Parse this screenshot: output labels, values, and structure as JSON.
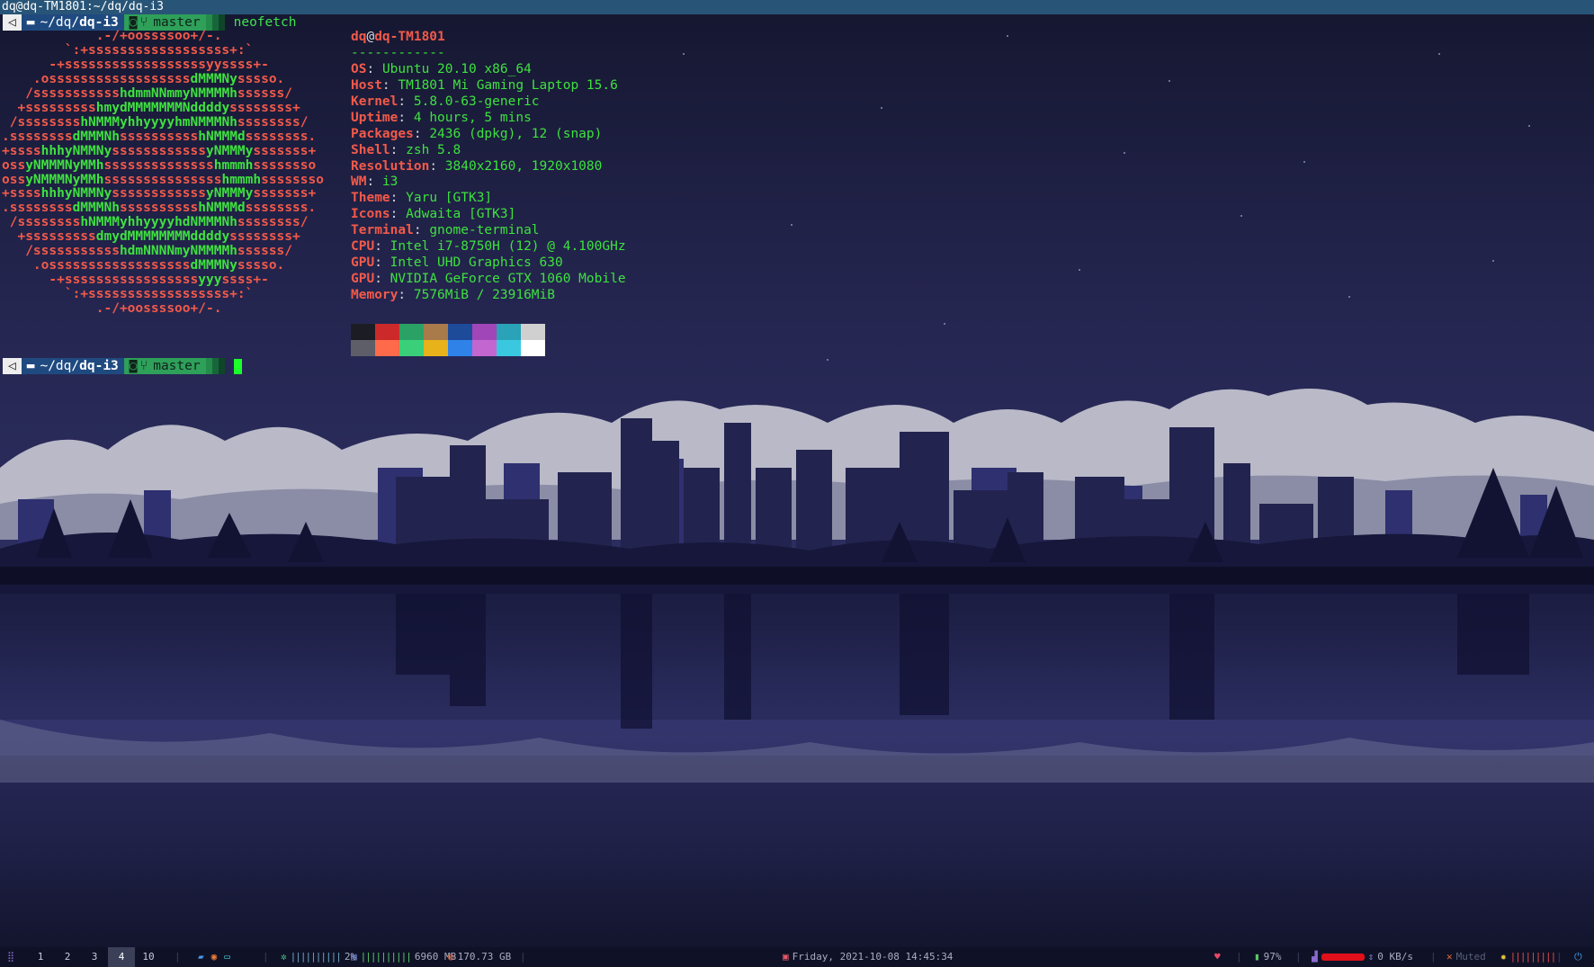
{
  "window": {
    "title": "dq@dq-TM1801:~/dq/dq-i3"
  },
  "prompt": {
    "dir_prefix": "~/dq/",
    "dir_name": "dq-i3",
    "branch": "master",
    "command": "neofetch"
  },
  "neofetch": {
    "user": "dq",
    "at": "@",
    "host": "dq-TM1801",
    "separator": "------------",
    "info": [
      {
        "key": "OS",
        "value": "Ubuntu 20.10 x86_64"
      },
      {
        "key": "Host",
        "value": "TM1801 Mi Gaming Laptop 15.6"
      },
      {
        "key": "Kernel",
        "value": "5.8.0-63-generic"
      },
      {
        "key": "Uptime",
        "value": "4 hours, 5 mins"
      },
      {
        "key": "Packages",
        "value": "2436 (dpkg), 12 (snap)"
      },
      {
        "key": "Shell",
        "value": "zsh 5.8"
      },
      {
        "key": "Resolution",
        "value": "3840x2160, 1920x1080"
      },
      {
        "key": "WM",
        "value": "i3"
      },
      {
        "key": "Theme",
        "value": "Yaru [GTK3]"
      },
      {
        "key": "Icons",
        "value": "Adwaita [GTK3]"
      },
      {
        "key": "Terminal",
        "value": "gnome-terminal"
      },
      {
        "key": "CPU",
        "value": "Intel i7-8750H (12) @ 4.100GHz"
      },
      {
        "key": "GPU",
        "value": "Intel UHD Graphics 630"
      },
      {
        "key": "GPU",
        "value": "NVIDIA GeForce GTX 1060 Mobile"
      },
      {
        "key": "Memory",
        "value": "7576MiB / 23916MiB"
      }
    ],
    "logo_lines": [
      [
        [
          "r",
          "            .-/+oossssoo+/-."
        ]
      ],
      [
        [
          "r",
          "        `:+ssssssssssssssssss+:`"
        ]
      ],
      [
        [
          "r",
          "      -+ssssssssssssssssssyyssss+-"
        ]
      ],
      [
        [
          "r",
          "    .ossssssssssssssssss"
        ],
        [
          "g",
          "dMMMNy"
        ],
        [
          "r",
          "sssso."
        ]
      ],
      [
        [
          "r",
          "   /sssssssssss"
        ],
        [
          "g",
          "hdmmNNmmyNMMMMh"
        ],
        [
          "r",
          "ssssss/"
        ]
      ],
      [
        [
          "r",
          "  +sssssssss"
        ],
        [
          "g",
          "hmydMMMMMMMNddddy"
        ],
        [
          "r",
          "ssssssss+"
        ]
      ],
      [
        [
          "r",
          " /ssssssss"
        ],
        [
          "g",
          "hNMMMyhhyyyyhmNMMMNh"
        ],
        [
          "r",
          "ssssssss/"
        ]
      ],
      [
        [
          "r",
          ".ssssssss"
        ],
        [
          "g",
          "dMMMNh"
        ],
        [
          "r",
          "ssssssssss"
        ],
        [
          "g",
          "hNMMMd"
        ],
        [
          "r",
          "ssssssss."
        ]
      ],
      [
        [
          "r",
          "+ssss"
        ],
        [
          "g",
          "hhhyNMMNy"
        ],
        [
          "r",
          "ssssssssssss"
        ],
        [
          "g",
          "yNMMMy"
        ],
        [
          "r",
          "sssssss+"
        ]
      ],
      [
        [
          "r",
          "oss"
        ],
        [
          "g",
          "yNMMMNyMMh"
        ],
        [
          "r",
          "ssssssssssssss"
        ],
        [
          "g",
          "hmmmh"
        ],
        [
          "r",
          "ssssssso"
        ]
      ],
      [
        [
          "r",
          "oss"
        ],
        [
          "g",
          "yNMMMNyMMh"
        ],
        [
          "r",
          "sssssssssssssss"
        ],
        [
          "g",
          "hmmmh"
        ],
        [
          "r",
          "ssssssso"
        ]
      ],
      [
        [
          "r",
          "+ssss"
        ],
        [
          "g",
          "hhhyNMMNy"
        ],
        [
          "r",
          "ssssssssssss"
        ],
        [
          "g",
          "yNMMMy"
        ],
        [
          "r",
          "sssssss+"
        ]
      ],
      [
        [
          "r",
          ".ssssssss"
        ],
        [
          "g",
          "dMMMNh"
        ],
        [
          "r",
          "ssssssssss"
        ],
        [
          "g",
          "hNMMMd"
        ],
        [
          "r",
          "ssssssss."
        ]
      ],
      [
        [
          "r",
          " /ssssssss"
        ],
        [
          "g",
          "hNMMMyhhyyyyhdNMMMNh"
        ],
        [
          "r",
          "ssssssss/"
        ]
      ],
      [
        [
          "r",
          "  +sssssssss"
        ],
        [
          "g",
          "dmydMMMMMMMMddddy"
        ],
        [
          "r",
          "ssssssss+"
        ]
      ],
      [
        [
          "r",
          "   /sssssssssss"
        ],
        [
          "g",
          "hdmNNNNmyNMMMMh"
        ],
        [
          "r",
          "ssssss/"
        ]
      ],
      [
        [
          "r",
          "    .ossssssssssssssssss"
        ],
        [
          "g",
          "dMMMNy"
        ],
        [
          "r",
          "sssso."
        ]
      ],
      [
        [
          "r",
          "      -+sssssssssssssssss"
        ],
        [
          "g",
          "yyy"
        ],
        [
          "r",
          "ssss+-"
        ]
      ],
      [
        [
          "r",
          "        `:+ssssssssssssssssss+:`"
        ]
      ],
      [
        [
          "r",
          "            .-/+oossssoo+/-."
        ]
      ]
    ],
    "palette": [
      "#1c1c24",
      "#cc2a2a",
      "#2aa266",
      "#a97a4a",
      "#1e4a9a",
      "#a046b8",
      "#2aa2b8",
      "#d0d0d0",
      "#5e5e68",
      "#ff6a4a",
      "#3ad07a",
      "#e8b21a",
      "#2e82e8",
      "#c466d0",
      "#3ac8e0",
      "#ffffff"
    ]
  },
  "colors": {
    "titlebar": "#285577",
    "logo_red": "#f25a4a",
    "logo_green": "#3ee13f",
    "prompt_dir_bg": "#1f4a80",
    "prompt_git_bg": "#2ea05a"
  },
  "statusbar": {
    "workspaces": [
      {
        "label": "1",
        "active": false
      },
      {
        "label": "2",
        "active": false
      },
      {
        "label": "3",
        "active": false
      },
      {
        "label": "4",
        "active": true
      },
      {
        "label": "10",
        "active": false
      }
    ],
    "cpu": "2%",
    "memory": "6960 MB",
    "disk": "170.73 GB",
    "datetime": "Friday, 2021-10-08 14:45:34",
    "battery": "97%",
    "network_speed": "0 KB/s",
    "volume": "Muted"
  }
}
